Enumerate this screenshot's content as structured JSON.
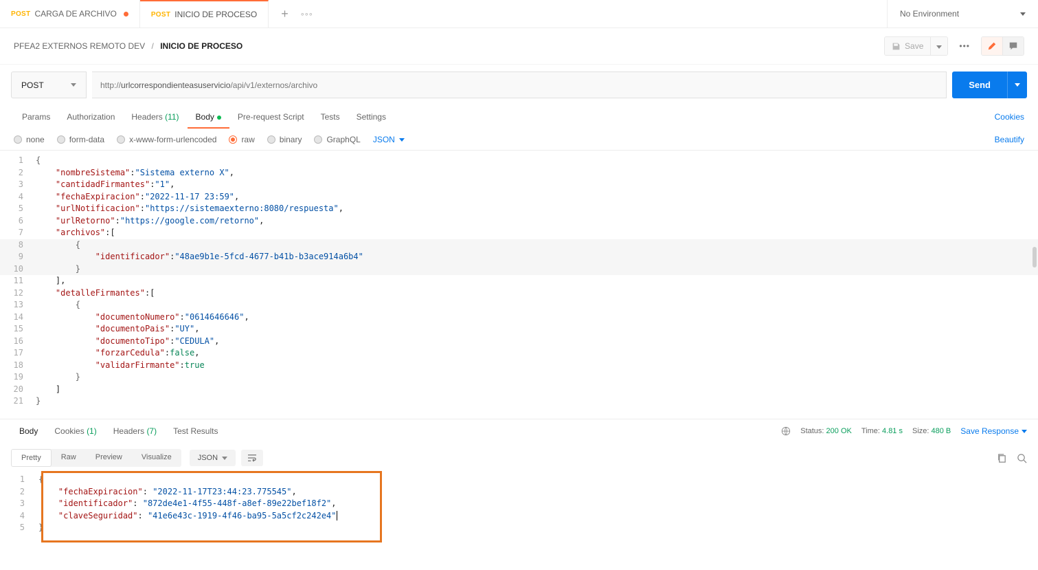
{
  "tabs": [
    {
      "method": "POST",
      "name": "CARGA DE ARCHIVO",
      "modified": true,
      "active": false
    },
    {
      "method": "POST",
      "name": "INICIO DE PROCESO",
      "modified": false,
      "active": true
    }
  ],
  "environment": {
    "selected": "No Environment"
  },
  "breadcrumb": {
    "path": "PFEA2 EXTERNOS REMOTO DEV",
    "current": "INICIO DE PROCESO"
  },
  "toolbar": {
    "save_label": "Save"
  },
  "request": {
    "method": "POST",
    "url_prefix": "http://",
    "url_host": "urlcorrespondienteasuservicio",
    "url_path": "/api/v1/externos/archivo",
    "send_label": "Send"
  },
  "subtabs": {
    "params": "Params",
    "authorization": "Authorization",
    "headers": "Headers",
    "headers_count": "(11)",
    "body": "Body",
    "prerequest": "Pre-request Script",
    "tests": "Tests",
    "settings": "Settings",
    "cookies": "Cookies"
  },
  "body_types": {
    "none": "none",
    "form_data": "form-data",
    "x_www": "x-www-form-urlencoded",
    "raw": "raw",
    "binary": "binary",
    "graphql": "GraphQL",
    "language": "JSON",
    "beautify": "Beautify"
  },
  "request_body_lines": [
    {
      "n": 1,
      "tokens": [
        [
          "brace",
          "{"
        ]
      ]
    },
    {
      "n": 2,
      "indent": 1,
      "tokens": [
        [
          "key",
          "\"nombreSistema\""
        ],
        [
          "punct",
          ":"
        ],
        [
          "str",
          "\"Sistema externo X\""
        ],
        [
          "punct",
          ","
        ]
      ]
    },
    {
      "n": 3,
      "indent": 1,
      "tokens": [
        [
          "key",
          "\"cantidadFirmantes\""
        ],
        [
          "punct",
          ":"
        ],
        [
          "str",
          "\"1\""
        ],
        [
          "punct",
          ","
        ]
      ]
    },
    {
      "n": 4,
      "indent": 1,
      "tokens": [
        [
          "key",
          "\"fechaExpiracion\""
        ],
        [
          "punct",
          ":"
        ],
        [
          "str",
          "\"2022-11-17 23:59\""
        ],
        [
          "punct",
          ","
        ]
      ]
    },
    {
      "n": 5,
      "indent": 1,
      "tokens": [
        [
          "key",
          "\"urlNotificacion\""
        ],
        [
          "punct",
          ":"
        ],
        [
          "str",
          "\"https://sistemaexterno:8080/respuesta\""
        ],
        [
          "punct",
          ","
        ]
      ]
    },
    {
      "n": 6,
      "indent": 1,
      "tokens": [
        [
          "key",
          "\"urlRetorno\""
        ],
        [
          "punct",
          ":"
        ],
        [
          "str",
          "\"https://google.com/retorno\""
        ],
        [
          "punct",
          ","
        ]
      ]
    },
    {
      "n": 7,
      "indent": 1,
      "tokens": [
        [
          "key",
          "\"archivos\""
        ],
        [
          "punct",
          ":["
        ]
      ]
    },
    {
      "n": 8,
      "indent": 2,
      "hl": true,
      "tokens": [
        [
          "brace",
          "{"
        ]
      ]
    },
    {
      "n": 9,
      "indent": 3,
      "hl": true,
      "tokens": [
        [
          "key",
          "\"identificador\""
        ],
        [
          "punct",
          ":"
        ],
        [
          "str",
          "\"48ae9b1e-5fcd-4677-b41b-b3ace914a6b4\""
        ]
      ]
    },
    {
      "n": 10,
      "indent": 2,
      "hl": true,
      "tokens": [
        [
          "brace",
          "}"
        ]
      ]
    },
    {
      "n": 11,
      "indent": 1,
      "tokens": [
        [
          "punct",
          "],"
        ]
      ]
    },
    {
      "n": 12,
      "indent": 1,
      "tokens": [
        [
          "key",
          "\"detalleFirmantes\""
        ],
        [
          "punct",
          ":["
        ]
      ]
    },
    {
      "n": 13,
      "indent": 2,
      "tokens": [
        [
          "brace",
          "{"
        ]
      ]
    },
    {
      "n": 14,
      "indent": 3,
      "tokens": [
        [
          "key",
          "\"documentoNumero\""
        ],
        [
          "punct",
          ":"
        ],
        [
          "str",
          "\"0614646646\""
        ],
        [
          "punct",
          ","
        ]
      ]
    },
    {
      "n": 15,
      "indent": 3,
      "tokens": [
        [
          "key",
          "\"documentoPais\""
        ],
        [
          "punct",
          ":"
        ],
        [
          "str",
          "\"UY\""
        ],
        [
          "punct",
          ","
        ]
      ]
    },
    {
      "n": 16,
      "indent": 3,
      "tokens": [
        [
          "key",
          "\"documentoTipo\""
        ],
        [
          "punct",
          ":"
        ],
        [
          "str",
          "\"CEDULA\""
        ],
        [
          "punct",
          ","
        ]
      ]
    },
    {
      "n": 17,
      "indent": 3,
      "tokens": [
        [
          "key",
          "\"forzarCedula\""
        ],
        [
          "punct",
          ":"
        ],
        [
          "bool",
          "false"
        ],
        [
          "punct",
          ","
        ]
      ]
    },
    {
      "n": 18,
      "indent": 3,
      "tokens": [
        [
          "key",
          "\"validarFirmante\""
        ],
        [
          "punct",
          ":"
        ],
        [
          "bool",
          "true"
        ]
      ]
    },
    {
      "n": 19,
      "indent": 2,
      "tokens": [
        [
          "brace",
          "}"
        ]
      ]
    },
    {
      "n": 20,
      "indent": 1,
      "tokens": [
        [
          "punct",
          "]"
        ]
      ]
    },
    {
      "n": 21,
      "tokens": [
        [
          "brace",
          "}"
        ]
      ]
    }
  ],
  "response_tabs": {
    "body": "Body",
    "cookies": "Cookies",
    "cookies_count": "(1)",
    "headers": "Headers",
    "headers_count": "(7)",
    "test_results": "Test Results"
  },
  "response_meta": {
    "status_label": "Status:",
    "status_value": "200 OK",
    "time_label": "Time:",
    "time_value": "4.81 s",
    "size_label": "Size:",
    "size_value": "480 B",
    "save_response": "Save Response"
  },
  "response_views": {
    "pretty": "Pretty",
    "raw": "Raw",
    "preview": "Preview",
    "visualize": "Visualize",
    "language": "JSON"
  },
  "response_body_lines": [
    {
      "n": 1,
      "indent": 0,
      "tokens": [
        [
          "brace",
          "{"
        ]
      ]
    },
    {
      "n": 2,
      "indent": 1,
      "tokens": [
        [
          "key",
          "\"fechaExpiracion\""
        ],
        [
          "punct",
          ": "
        ],
        [
          "str",
          "\"2022-11-17T23:44:23.775545\""
        ],
        [
          "punct",
          ","
        ]
      ]
    },
    {
      "n": 3,
      "indent": 1,
      "tokens": [
        [
          "key",
          "\"identificador\""
        ],
        [
          "punct",
          ": "
        ],
        [
          "str",
          "\"872de4e1-4f55-448f-a8ef-89e22bef18f2\""
        ],
        [
          "punct",
          ","
        ]
      ]
    },
    {
      "n": 4,
      "indent": 1,
      "tokens": [
        [
          "key",
          "\"claveSeguridad\""
        ],
        [
          "punct",
          ": "
        ],
        [
          "str",
          "\"41e6e43c-1919-4f46-ba95-5a5cf2c242e4\""
        ]
      ],
      "cursor": true
    },
    {
      "n": 5,
      "indent": 0,
      "tokens": [
        [
          "brace",
          "}"
        ]
      ]
    }
  ]
}
